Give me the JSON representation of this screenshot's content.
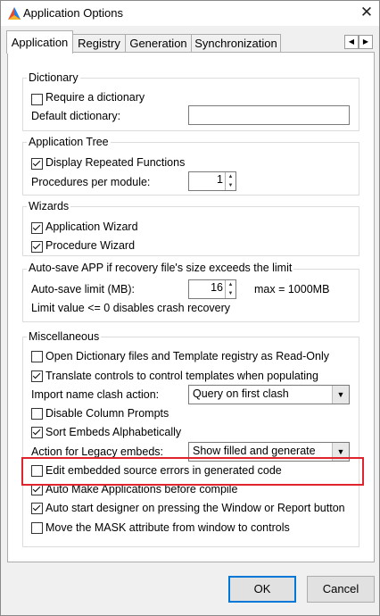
{
  "window": {
    "title": "Application Options"
  },
  "tabs": [
    {
      "label": "Application"
    },
    {
      "label": "Registry"
    },
    {
      "label": "Generation"
    },
    {
      "label": "Synchronization"
    }
  ],
  "dictionary": {
    "group_label": "Dictionary",
    "require_label": "Require a dictionary",
    "require_checked": false,
    "default_label": "Default dictionary:",
    "default_value": ""
  },
  "app_tree": {
    "group_label": "Application Tree",
    "display_repeated_label": "Display Repeated Functions",
    "display_repeated_checked": true,
    "procs_label": "Procedures per module:",
    "procs_value": "1"
  },
  "wizards": {
    "group_label": "Wizards",
    "app_wizard_label": "Application Wizard",
    "app_wizard_checked": true,
    "proc_wizard_label": "Procedure Wizard",
    "proc_wizard_checked": true
  },
  "autosave": {
    "group_label": "Auto-save APP if recovery file's size exceeds the limit",
    "limit_label": "Auto-save limit (MB):",
    "limit_value": "16",
    "max_text": "max = 1000MB",
    "note": "Limit value <= 0 disables crash recovery"
  },
  "misc": {
    "group_label": "Miscellaneous",
    "open_readonly_label": "Open Dictionary files and Template registry as Read-Only",
    "translate_label": "Translate controls to control templates when populating",
    "import_clash_label": "Import name clash action:",
    "import_clash_value": "Query on first clash",
    "disable_prompts_label": "Disable Column Prompts",
    "sort_embeds_label": "Sort Embeds Alphabetically",
    "legacy_label": "Action for Legacy embeds:",
    "legacy_value": "Show filled and generate",
    "edit_errors_label": "Edit embedded source errors in generated code",
    "auto_make_label": "Auto Make Applications before compile",
    "auto_start_label": "Auto start designer on pressing the Window or Report button",
    "move_mask_label": "Move the MASK attribute from window to controls"
  },
  "buttons": {
    "ok": "OK",
    "cancel": "Cancel"
  },
  "colors": {
    "highlight": "#e0242e",
    "accent": "#0078d7"
  }
}
